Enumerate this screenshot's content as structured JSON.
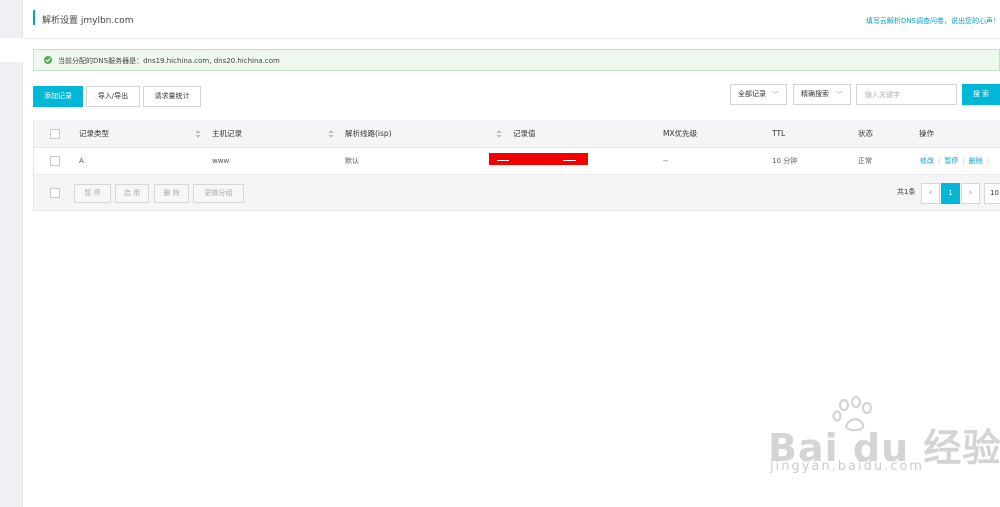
{
  "header": {
    "title": "解析设置 jmylbn.com",
    "survey_link": "填写云解析DNS调查问卷，说出您的心声！"
  },
  "notice": {
    "text": "当前分配的DNS服务器是：dns19.hichina.com, dns20.hichina.com",
    "icon": "check-circle-icon"
  },
  "toolbar": {
    "add_record": "添加记录",
    "import_export": "导入/导出",
    "request_stats": "请求量统计",
    "record_filter": "全部记录",
    "search_mode": "精确搜索",
    "search_placeholder": "输入关键字",
    "search_button": "搜 索"
  },
  "table": {
    "columns": [
      "记录类型",
      "主机记录",
      "解析线路(isp)",
      "记录值",
      "MX优先级",
      "TTL",
      "状态",
      "操作"
    ],
    "rows": [
      {
        "type": "A",
        "host": "www",
        "line": "默认",
        "value": "",
        "mx": "--",
        "ttl": "10 分钟",
        "status": "正常",
        "actions": [
          "修改",
          "暂停",
          "删除"
        ]
      }
    ]
  },
  "bulk_actions": {
    "pause": "暂 停",
    "enable": "启 用",
    "delete": "删 除",
    "change_group": "更换分组"
  },
  "pagination": {
    "total": "共1条",
    "prev": "‹",
    "current": "1",
    "next": "›",
    "page_size": "10"
  },
  "watermark": {
    "brand": "Bai du 经验",
    "url": "jingyan.baidu.com"
  },
  "colors": {
    "accent": "#00b7d8",
    "link": "#00a2ca",
    "status_ok": "#2b9b3b",
    "notice_bg": "#eef8ee"
  }
}
